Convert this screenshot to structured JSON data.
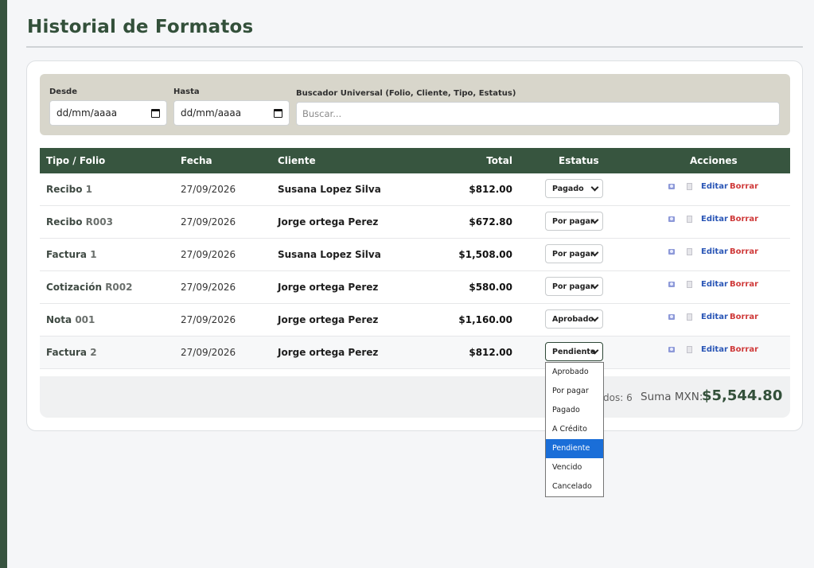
{
  "page": {
    "title": "Historial de Formatos"
  },
  "filters": {
    "desde_label": "Desde",
    "desde_value": "dd/mm/aaaa",
    "hasta_label": "Hasta",
    "hasta_value": "dd/mm/aaaa",
    "search_label": "Buscador Universal (Folio, Cliente, Tipo, Estatus)",
    "search_placeholder": "Buscar..."
  },
  "table": {
    "headers": {
      "tipo": "Tipo / Folio",
      "fecha": "Fecha",
      "cliente": "Cliente",
      "total": "Total",
      "estatus": "Estatus",
      "acciones": "Acciones"
    },
    "rows": [
      {
        "tipo": "Recibo",
        "folio": "1",
        "fecha": "27/09/2026",
        "cliente": "Susana Lopez Silva",
        "total": "$812.00",
        "estatus": "Pagado"
      },
      {
        "tipo": "Recibo",
        "folio": "R003",
        "fecha": "27/09/2026",
        "cliente": "Jorge ortega Perez",
        "total": "$672.80",
        "estatus": "Por pagar"
      },
      {
        "tipo": "Factura",
        "folio": "1",
        "fecha": "27/09/2026",
        "cliente": "Susana Lopez Silva",
        "total": "$1,508.00",
        "estatus": "Por pagar"
      },
      {
        "tipo": "Cotización",
        "folio": "R002",
        "fecha": "27/09/2026",
        "cliente": "Jorge ortega Perez",
        "total": "$580.00",
        "estatus": "Por pagar"
      },
      {
        "tipo": "Nota",
        "folio": "001",
        "fecha": "27/09/2026",
        "cliente": "Jorge ortega Perez",
        "total": "$1,160.00",
        "estatus": "Aprobado"
      },
      {
        "tipo": "Factura",
        "folio": "2",
        "fecha": "27/09/2026",
        "cliente": "Jorge ortega Perez",
        "total": "$812.00",
        "estatus": "Pendiente"
      }
    ],
    "edit_label": "Editar",
    "delete_label": "Borrar",
    "view_icon": "eye-icon",
    "doc_icon": "document-icon"
  },
  "summary": {
    "docs_count": "dos: 6",
    "sum_label": "Suma MXN:",
    "sum_value": "$5,544.80"
  },
  "dropdown": {
    "options": [
      "Aprobado",
      "Por pagar",
      "Pagado",
      "A Crédito",
      "Pendiente",
      "Vencido",
      "Cancelado"
    ],
    "selected": "Pendiente"
  },
  "colors": {
    "brand_green": "#37553f",
    "edit_blue": "#2a56b6",
    "delete_red": "#cf3a3a",
    "selected_blue": "#1a6ed8"
  }
}
